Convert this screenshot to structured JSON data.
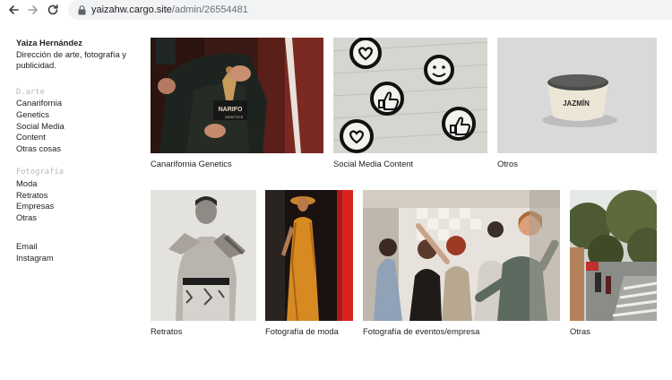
{
  "browser": {
    "url_host": "yaizahw.cargo.site",
    "url_path": "/admin/26554481"
  },
  "sidebar": {
    "title": "Yaiza Hernández",
    "tagline": "Dirección de arte, fotografía y publicidad.",
    "section_art": "D.arte",
    "art_items": [
      "Canarifornia",
      "Genetics",
      "Social Media",
      "Content",
      "Otras cosas"
    ],
    "section_photo": "Fotografía",
    "photo_items": [
      "Moda",
      "Retratos",
      "Empresas",
      "Otras"
    ],
    "contact_items": [
      "Email",
      "Instagram"
    ]
  },
  "gallery": {
    "row1": [
      {
        "caption": "Canarifornia Genetics",
        "shirt_text": "NARIFO",
        "shirt_sub": "GENETICS"
      },
      {
        "caption": "Social Media Content"
      },
      {
        "caption": "Otros",
        "product_label": "JAZMÍN"
      }
    ],
    "row2": [
      {
        "caption": "Retratos"
      },
      {
        "caption": "Fotografía de moda"
      },
      {
        "caption": "Fotografía de eventos/empresa"
      },
      {
        "caption": "Otras"
      }
    ]
  }
}
